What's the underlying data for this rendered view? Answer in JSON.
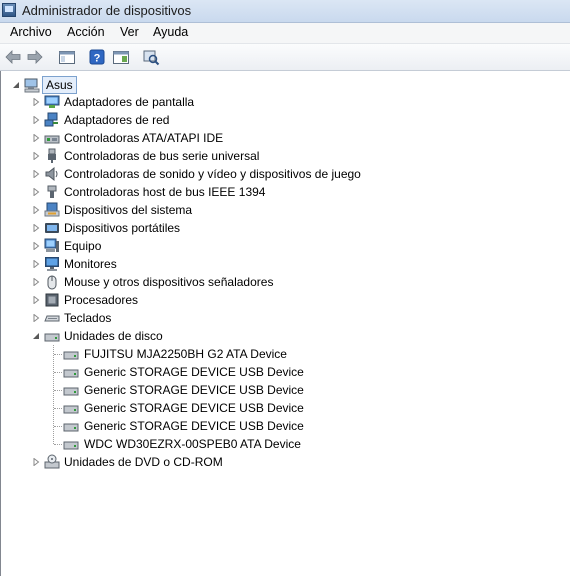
{
  "window": {
    "title": "Administrador de dispositivos"
  },
  "menu": [
    "Archivo",
    "Acción",
    "Ver",
    "Ayuda"
  ],
  "toolbar": {
    "icons": [
      "back-arrow-icon",
      "forward-arrow-icon",
      "console-tree-icon",
      "properties-icon",
      "help-icon",
      "action-pane-icon",
      "scan-hardware-icon"
    ]
  },
  "tree": {
    "root": "Asus",
    "categories": [
      "Adaptadores de pantalla",
      "Adaptadores de red",
      "Controladoras ATA/ATAPI IDE",
      "Controladoras de bus serie universal",
      "Controladoras de sonido y vídeo y dispositivos de juego",
      "Controladoras host de bus IEEE 1394",
      "Dispositivos del sistema",
      "Dispositivos portátiles",
      "Equipo",
      "Monitores",
      "Mouse y otros dispositivos señaladores",
      "Procesadores",
      "Teclados",
      "Unidades de disco",
      "Unidades de DVD o CD-ROM"
    ],
    "disk_drives": [
      "FUJITSU MJA2250BH G2 ATA Device",
      "Generic STORAGE DEVICE USB Device",
      "Generic STORAGE DEVICE USB Device",
      "Generic STORAGE DEVICE USB Device",
      "Generic STORAGE DEVICE USB Device",
      "WDC WD30EZRX-00SPEB0 ATA Device"
    ]
  }
}
